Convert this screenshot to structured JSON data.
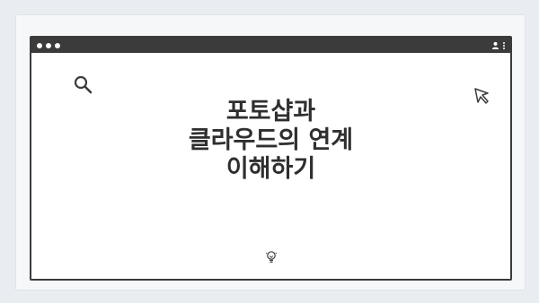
{
  "window": {
    "title_lines": [
      "포토샵과",
      "클라우드의 연계",
      "이해하기"
    ]
  },
  "icons": {
    "search": "search-icon",
    "cursor": "cursor-icon",
    "lightbulb": "lightbulb-icon",
    "user": "user-icon",
    "menu": "kebab-menu-icon"
  },
  "colors": {
    "titlebar": "#3b3b3b",
    "background": "#e9ecf1",
    "text": "#2f2f2f"
  }
}
